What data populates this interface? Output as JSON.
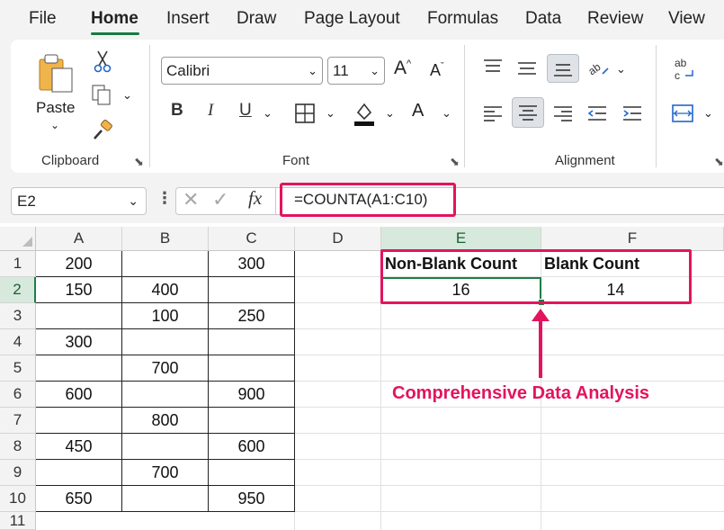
{
  "menu": {
    "tabs": [
      "File",
      "Home",
      "Insert",
      "Draw",
      "Page Layout",
      "Formulas",
      "Data",
      "Review",
      "View"
    ],
    "active": "Home"
  },
  "ribbon": {
    "clipboard": {
      "paste_label": "Paste",
      "group_label": "Clipboard"
    },
    "font": {
      "font_name": "Calibri",
      "font_size": "11",
      "bold": "B",
      "italic": "I",
      "underline": "U",
      "font_color_glyph": "A",
      "group_label": "Font"
    },
    "alignment": {
      "group_label": "Alignment",
      "wrap_glyph": "ab\nc"
    }
  },
  "formula_bar": {
    "name_box": "E2",
    "fx_label": "fx",
    "formula": "=COUNTA(A1:C10)"
  },
  "sheet": {
    "columns": [
      "A",
      "B",
      "C",
      "D",
      "E",
      "F"
    ],
    "selected_column": "E",
    "rows": [
      "1",
      "2",
      "3",
      "4",
      "5",
      "6",
      "7",
      "8",
      "9",
      "10",
      "11"
    ],
    "selected_row": "2",
    "values": {
      "A1": "200",
      "C1": "300",
      "A2": "150",
      "B2": "400",
      "B3": "100",
      "C3": "250",
      "A4": "300",
      "B5": "700",
      "A6": "600",
      "C6": "900",
      "B7": "800",
      "A8": "450",
      "C8": "600",
      "B9": "700",
      "A10": "650",
      "C10": "950",
      "E1": "Non-Blank Count",
      "F1": "Blank Count",
      "E2": "16",
      "F2": "14"
    }
  },
  "annotation": {
    "text": "Comprehensive Data Analysis",
    "color": "#e3145e"
  },
  "colors": {
    "accent_green": "#1f7d46",
    "highlight_pink": "#e3145e"
  }
}
